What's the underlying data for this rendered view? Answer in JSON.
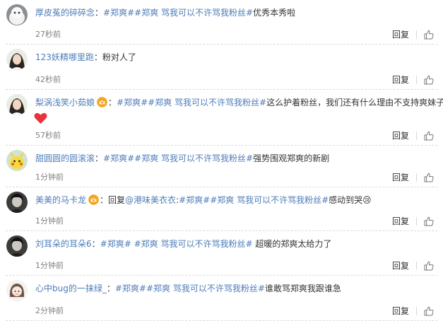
{
  "reply_label": "回复",
  "colors": {
    "link": "#4d7cb8",
    "text": "#333333",
    "muted": "#808080",
    "heart": "#e8333a",
    "crown": "#f2a51c"
  },
  "comments": [
    {
      "user": "厚皮菟的碎碎念",
      "separator": "：",
      "segments": [
        {
          "t": "#郑爽##郑爽 骂我可以不许骂我粉丝#",
          "link": true
        },
        {
          "t": "优秀本秀啦",
          "link": false
        }
      ],
      "time": "27秒前",
      "avatar_icon": "white-creature-avatar"
    },
    {
      "user": "123妖精哪里跑",
      "separator": "：",
      "segments": [
        {
          "t": "粉对人了",
          "link": false
        }
      ],
      "time": "42秒前",
      "avatar_icon": "girl-portrait-avatar"
    },
    {
      "user": "梨涡浅笑小茹娘",
      "separator": "：",
      "segments": [
        {
          "t": "#郑爽##郑爽 骂我可以不许骂我粉丝#",
          "link": true
        },
        {
          "t": "这么护着粉丝，我们还有什么理由不支持爽妹子",
          "link": false
        }
      ],
      "time": "57秒前",
      "avatar_icon": "girl-portrait-avatar",
      "crown": true,
      "heart": true
    },
    {
      "user": "甜圆圆的圆滚滚",
      "separator": "：",
      "segments": [
        {
          "t": "#郑爽##郑爽 骂我可以不许骂我粉丝#",
          "link": true
        },
        {
          "t": "强势围观郑爽的新剧",
          "link": false
        }
      ],
      "time": "1分钟前",
      "avatar_icon": "pikachu-avatar"
    },
    {
      "user": "美美的马卡龙",
      "separator": "：",
      "segments": [
        {
          "t": "回复",
          "link": false
        },
        {
          "t": "@港味美衣衣",
          "link": true
        },
        {
          "t": ":",
          "link": false
        },
        {
          "t": "#郑爽##郑爽 骂我可以不许骂我粉丝#",
          "link": true
        },
        {
          "t": "感动到哭😢",
          "link": false
        }
      ],
      "time": "1分钟前",
      "avatar_icon": "dark-portrait-avatar",
      "crown": true
    },
    {
      "user": "刘耳朵的耳朵6",
      "separator": "：",
      "segments": [
        {
          "t": "#郑爽# #郑爽 骂我可以不许骂我粉丝#",
          "link": true
        },
        {
          "t": " 超暖的郑爽太给力了",
          "link": false
        }
      ],
      "time": "1分钟前",
      "avatar_icon": "dark-portrait-avatar"
    },
    {
      "user": "心中bug的一抹绿_",
      "separator": "：",
      "segments": [
        {
          "t": "#郑爽##郑爽 骂我可以不许骂我粉丝#",
          "link": true
        },
        {
          "t": "谁敢骂郑爽我跟谁急",
          "link": false
        }
      ],
      "time": "2分钟前",
      "avatar_icon": "cartoon-girl-avatar"
    }
  ]
}
